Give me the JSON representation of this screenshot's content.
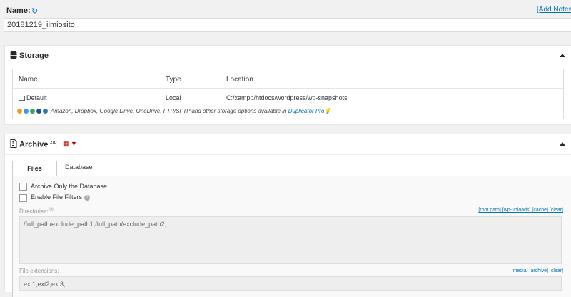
{
  "name_section": {
    "label": "Name:",
    "value": "20181219_ilmiosito",
    "add_notes": "[Add Notes"
  },
  "storage": {
    "title": "Storage",
    "columns": [
      "Name",
      "Type",
      "Location"
    ],
    "row": {
      "name": "Default",
      "type": "Local",
      "location": "C:/xampp/htdocs/wordpress/wp-snapshots"
    },
    "pro_text": "Amazon, Dropbox, Google Drive, OneDrive, FTP/SFTP and other storage options available in",
    "pro_link": "Duplicator Pro"
  },
  "archive": {
    "title": "Archive",
    "zip": "zip",
    "tabs": [
      "Files",
      "Database"
    ],
    "archive_only_db": "Archive Only the Database",
    "enable_filters": "Enable File Filters",
    "directories_label": "Directories:",
    "directories_count": "(0)",
    "dir_links": "[root path] [wp-uploads] [cache] [clear]",
    "directories_value": "/full_path/exclude_path1;/full_path/exclude_path2;",
    "ext_label": "File extensions:",
    "ext_links": "[media] [archive] [clear]",
    "ext_value": "ext1;ext2;ext3;"
  },
  "colors": {
    "link": "#0073aa",
    "accent": "#b00000"
  }
}
